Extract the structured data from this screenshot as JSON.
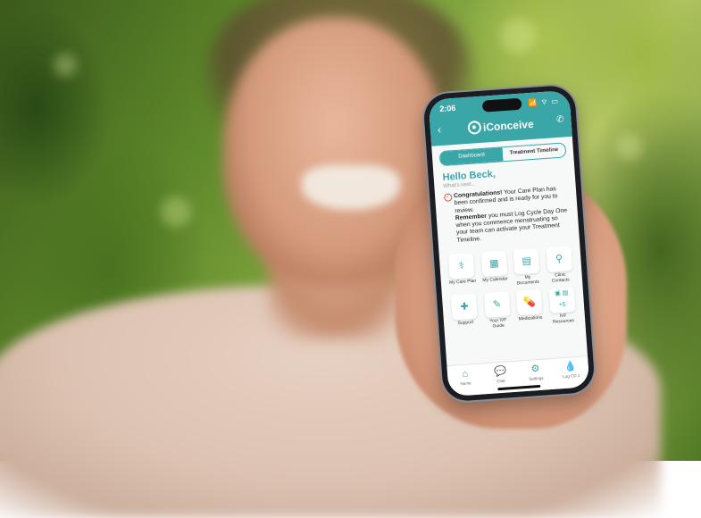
{
  "status_bar": {
    "time": "2:06",
    "icons": "📶 ⌔ ▭"
  },
  "app": {
    "title": "iConceive"
  },
  "tabs": [
    {
      "label": "Dashboard",
      "active": true
    },
    {
      "label": "Treatment Timeline",
      "active": false
    }
  ],
  "greeting": "Hello Beck,",
  "subtitle": "What's next...",
  "message": {
    "bold1": "Congratulations!",
    "text1": " Your Care Plan has been confirmed and is ready for you to review.",
    "bold2": "Remember",
    "text2": " you must Log Cycle Day One when you commence menstruating so your team can activate your Treatment Timeline."
  },
  "tiles": [
    {
      "label": "My Care Plan",
      "icon": "stethoscope-icon"
    },
    {
      "label": "My Calendar",
      "icon": "calendar-icon"
    },
    {
      "label": "My Documents",
      "icon": "documents-icon"
    },
    {
      "label": "Clinic Contacts",
      "icon": "location-pin-icon"
    },
    {
      "label": "Support",
      "icon": "first-aid-icon"
    },
    {
      "label": "Your IVF Guide",
      "icon": "guide-icon"
    },
    {
      "label": "Medications",
      "icon": "pill-icon"
    },
    {
      "label": "IVF Resources",
      "icon": "resources-icon",
      "badge": "+5"
    }
  ],
  "nav": [
    {
      "label": "Home",
      "icon": "home-icon"
    },
    {
      "label": "Chat",
      "icon": "chat-icon"
    },
    {
      "label": "Settings",
      "icon": "settings-icon"
    },
    {
      "label": "Log CD 1",
      "icon": "drop-icon"
    }
  ],
  "colors": {
    "accent": "#3aa6a8",
    "alert": "#e0584e"
  }
}
